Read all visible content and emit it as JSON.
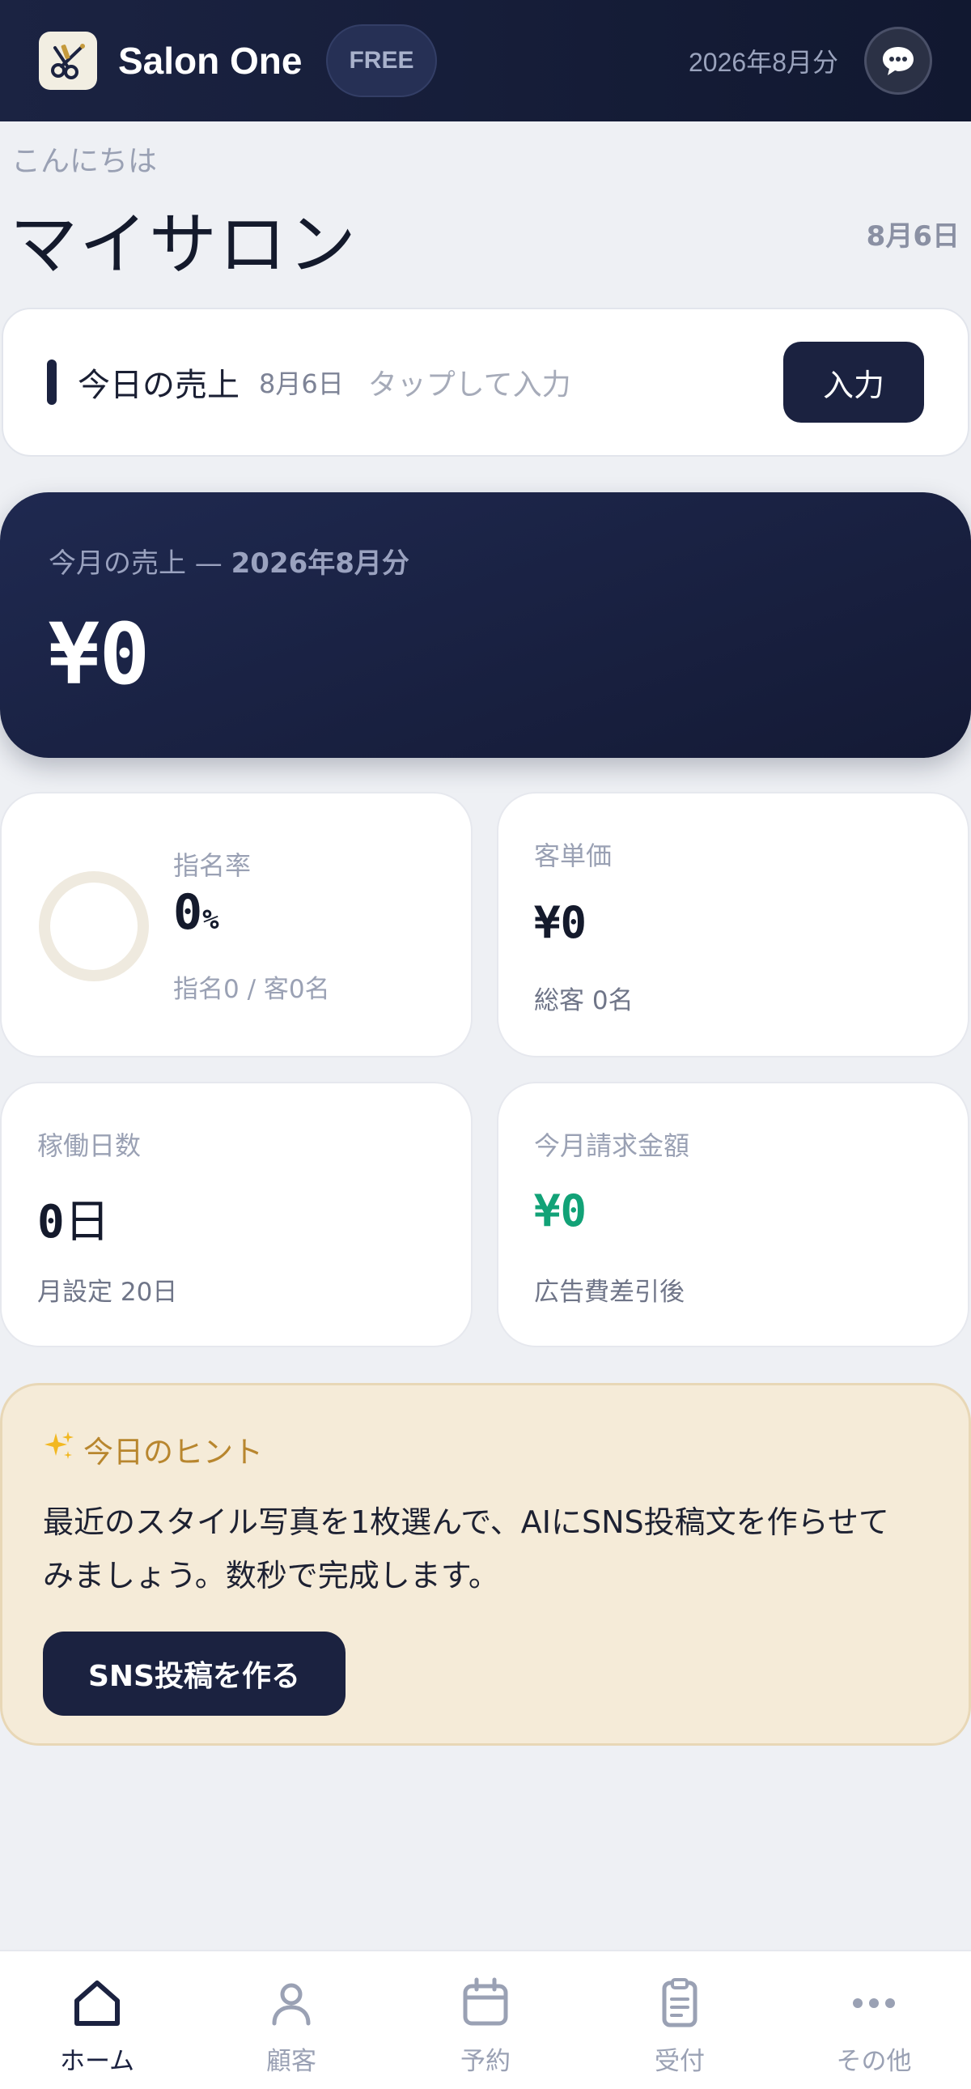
{
  "header": {
    "app_title": "Salon One",
    "plan_badge": "FREE",
    "month": "2026年8月分",
    "logo_icon": "scissors-comb-icon",
    "chat_icon": "speech-bubble-icon"
  },
  "greeting": {
    "hello": "こんにちは",
    "salon_name": "マイサロン",
    "date": "8月6日"
  },
  "today_sales": {
    "title": "今日の売上",
    "date": "8月6日",
    "hint": "タップして入力",
    "button_label": "入力"
  },
  "month_sales": {
    "label_prefix": "今月の売上 — ",
    "label_month": "2026年8月分",
    "amount": "¥0"
  },
  "stats": {
    "nomination": {
      "label": "指名率",
      "value": "0",
      "unit": "%",
      "sub": "指名0 / 客0名",
      "ratio": 0
    },
    "unit_price": {
      "label": "客単価",
      "value": "¥0",
      "sub": "総客 0名"
    },
    "work_days": {
      "label": "稼働日数",
      "value": "0",
      "unit": "日",
      "sub": "月設定 20日"
    },
    "billing": {
      "label": "今月請求金額",
      "value": "¥0",
      "sub": "広告費差引後"
    }
  },
  "tip": {
    "title": "今日のヒント",
    "body_line1": "最近のスタイル写真を1枚選んで、AIにSNS投稿文を作らせて",
    "body_line2": "みましょう。数秒で完成します。",
    "button_label": "SNS投稿を作る"
  },
  "nav": {
    "home": "ホーム",
    "customers": "顧客",
    "reservations": "予約",
    "reception": "受付",
    "more": "その他"
  },
  "colors": {
    "navy": "#1b2240",
    "green": "#12a277",
    "gold": "#b8862e",
    "ring": "#efeadf"
  }
}
